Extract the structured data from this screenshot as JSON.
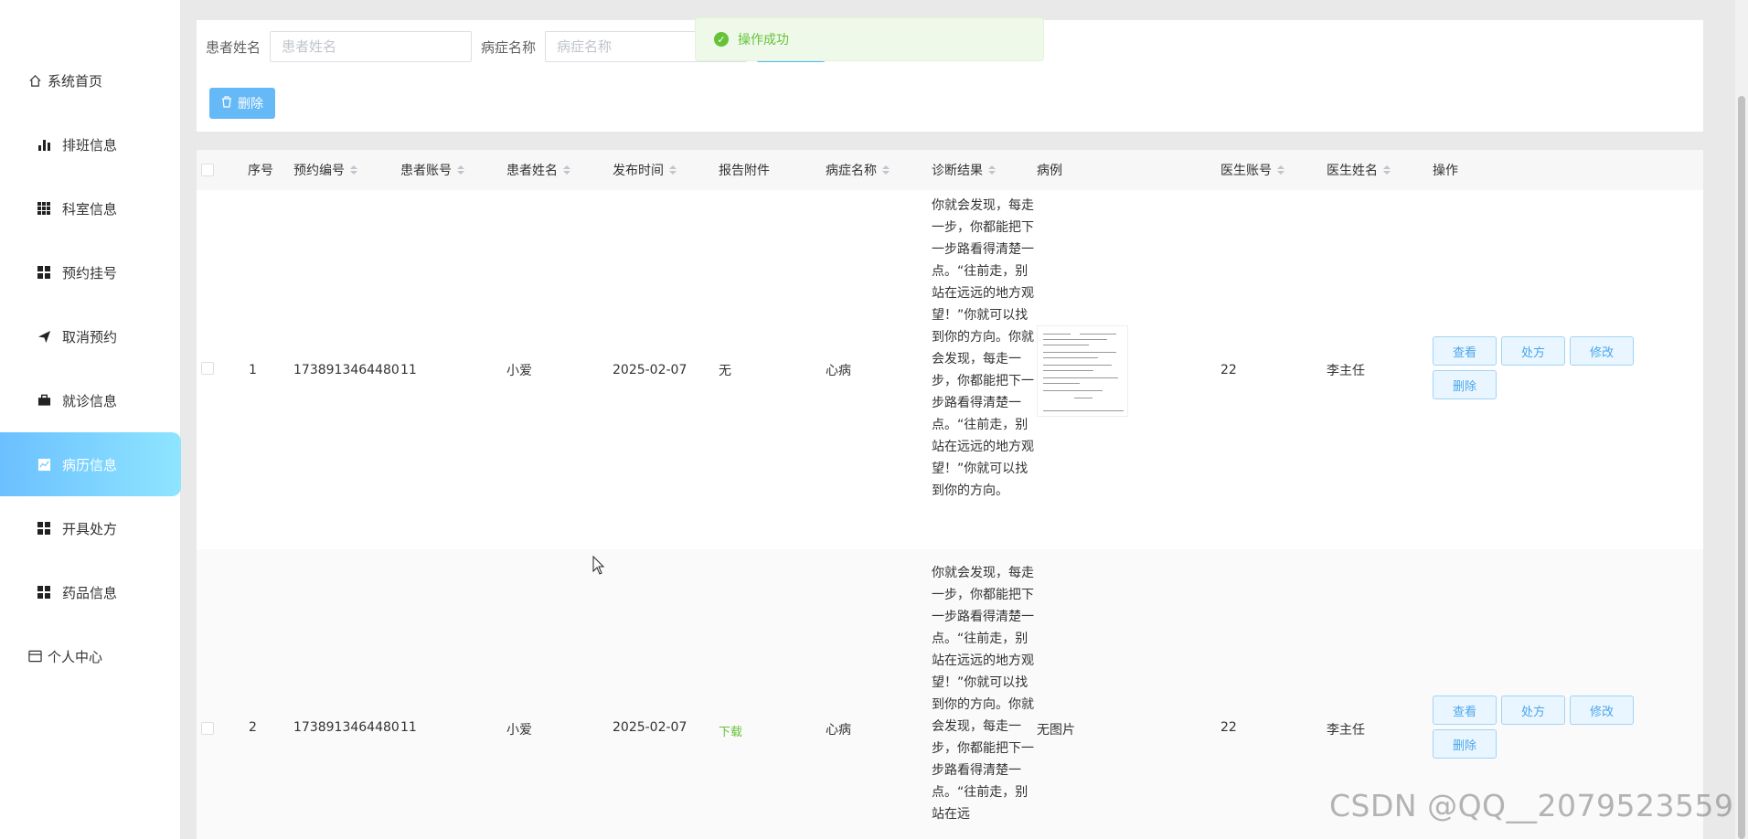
{
  "sidebar": {
    "items": [
      {
        "label": "系统首页",
        "icon": "home-icon"
      },
      {
        "label": "排班信息",
        "icon": "bar-chart-icon"
      },
      {
        "label": "科室信息",
        "icon": "grid-icon"
      },
      {
        "label": "预约挂号",
        "icon": "apps-icon"
      },
      {
        "label": "取消预约",
        "icon": "send-icon"
      },
      {
        "label": "就诊信息",
        "icon": "briefcase-icon"
      },
      {
        "label": "病历信息",
        "icon": "chart-icon",
        "active": true
      },
      {
        "label": "开具处方",
        "icon": "apps-icon"
      },
      {
        "label": "药品信息",
        "icon": "apps-icon"
      },
      {
        "label": "个人中心",
        "icon": "card-icon"
      }
    ]
  },
  "search": {
    "patient_name_label": "患者姓名",
    "patient_name_placeholder": "患者姓名",
    "disease_label": "病症名称",
    "disease_placeholder": "病症名称",
    "delete_label": "删除"
  },
  "toast": {
    "message": "操作成功",
    "color": "#67c23a"
  },
  "table": {
    "headers": {
      "index": "序号",
      "appointment_no": "预约编号",
      "patient_account": "患者账号",
      "patient_name": "患者姓名",
      "publish_time": "发布时间",
      "report": "报告附件",
      "disease": "病症名称",
      "diagnosis": "诊断结果",
      "case": "病例",
      "doctor_account": "医生账号",
      "doctor_name": "医生姓名",
      "actions": "操作"
    },
    "rows": [
      {
        "index": "1",
        "appointment_no": "1738913464480",
        "patient_account": "11",
        "patient_name": "小爱",
        "publish_time": "2025-02-07",
        "report": "无",
        "disease": "心病",
        "diagnosis": "你就会发现，每走一步，你都能把下一步路看得清楚一点。“往前走，别站在远远的地方观望！”你就可以找到你的方向。你就会发现，每走一步，你都能把下一步路看得清楚一点。“往前走，别站在远远的地方观望！”你就可以找到你的方向。",
        "case": "",
        "doctor_account": "22",
        "doctor_name": "李主任"
      },
      {
        "index": "2",
        "appointment_no": "1738913464480",
        "patient_account": "11",
        "patient_name": "小爱",
        "publish_time": "2025-02-07",
        "report": "下载",
        "disease": "心病",
        "diagnosis": "你就会发现，每走一步，你都能把下一步路看得清楚一点。“往前走，别站在远远的地方观望！”你就可以找到你的方向。你就会发现，每走一步，你都能把下一步路看得清楚一点。“往前走，别站在远",
        "case": "无图片",
        "doctor_account": "22",
        "doctor_name": "李主任"
      }
    ],
    "actions": {
      "view": "查看",
      "prescribe": "处方",
      "edit": "修改",
      "delete": "删除"
    }
  },
  "watermark": "CSDN @QQ__2079523559",
  "colors": {
    "accent": "#54b7ff",
    "active_gradient_start": "#6bc0ff",
    "active_gradient_end": "#8ee5ff",
    "success": "#67c23a"
  }
}
